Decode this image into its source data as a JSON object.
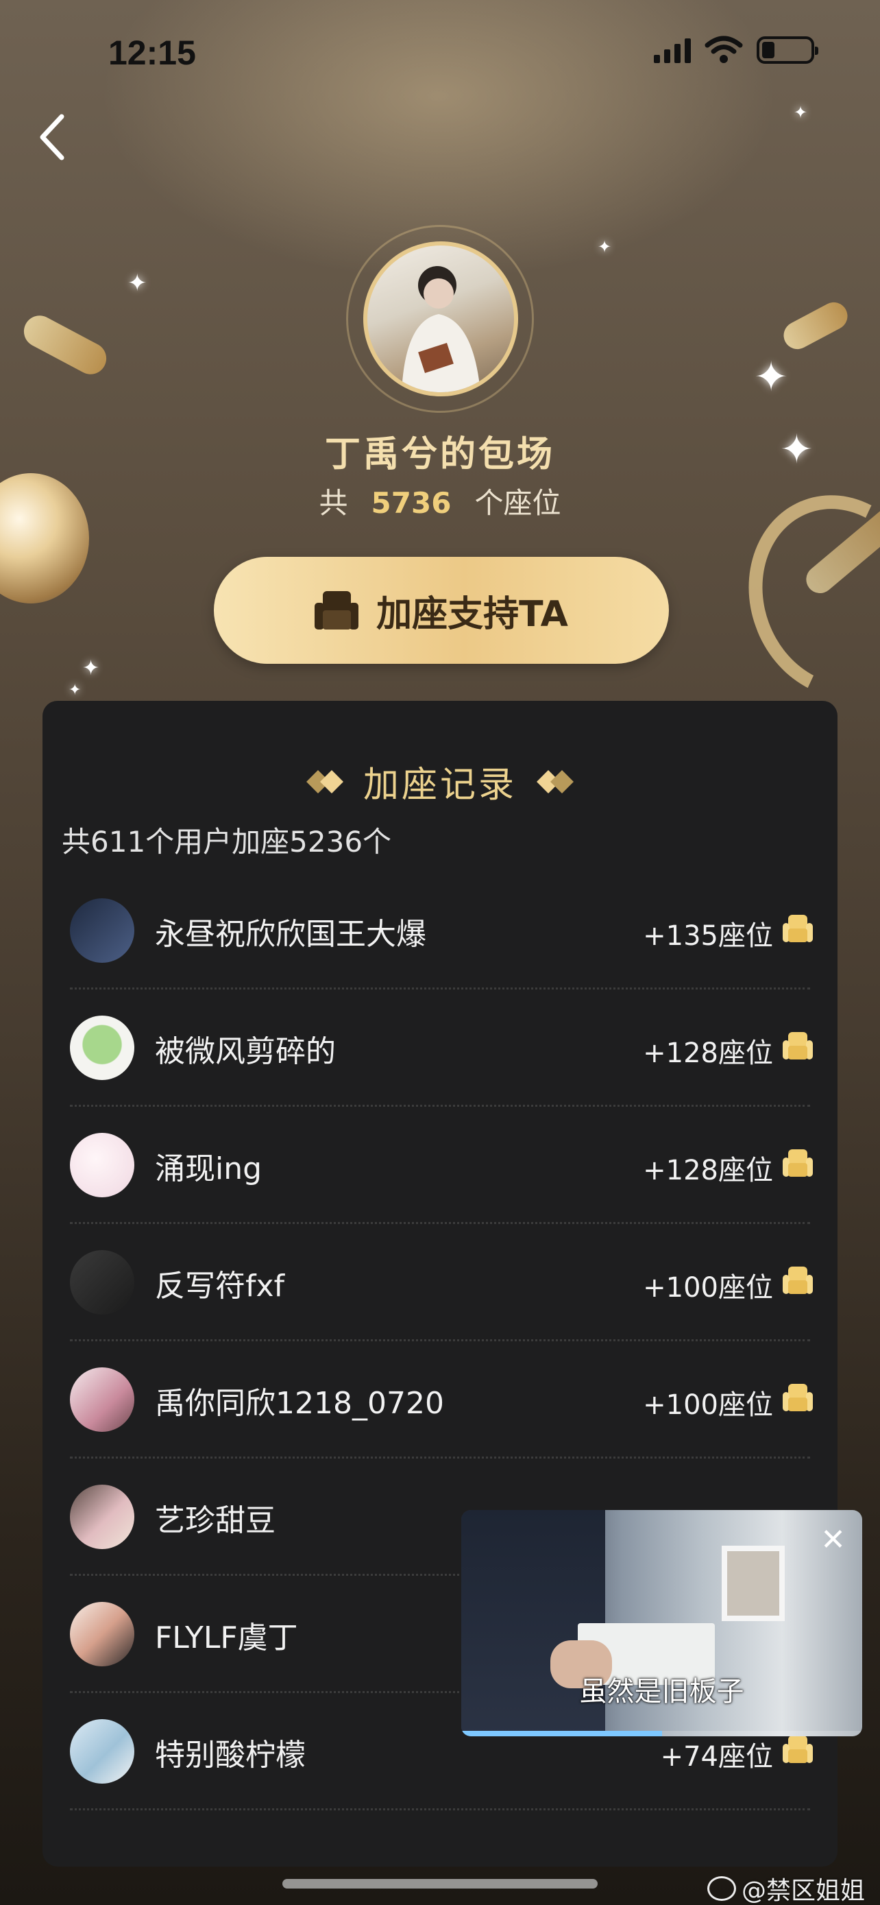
{
  "status_bar": {
    "time": "12:15",
    "battery_level": 0.2
  },
  "header": {
    "back_icon": "chevron-left-icon"
  },
  "profile": {
    "title": "丁禹兮的包场",
    "total_prefix": "共",
    "total_seats": "5736",
    "total_suffix": "个座位"
  },
  "support_button": {
    "label": "加座支持TA",
    "icon": "sofa-icon"
  },
  "records": {
    "title": "加座记录",
    "summary": "共611个用户加座5236个",
    "items": [
      {
        "name": "永昼祝欣欣国王大爆",
        "seats": "+135座位",
        "avatar_color": "#3a4a66"
      },
      {
        "name": "被微风剪碎的",
        "seats": "+128座位",
        "avatar_color": "#9fd08a"
      },
      {
        "name": "涌现ing",
        "seats": "+128座位",
        "avatar_color": "#f2dfe6"
      },
      {
        "name": "反写符fxf",
        "seats": "+100座位",
        "avatar_color": "#2b2b2b"
      },
      {
        "name": "禹你同欣1218_0720",
        "seats": "+100座位",
        "avatar_color": "#d9b7c2"
      },
      {
        "name": "艺珍甜豆",
        "seats": "",
        "avatar_color": "#c9a69a"
      },
      {
        "name": "FLYLF虞丁",
        "seats": "",
        "avatar_color": "#e8d6cc"
      },
      {
        "name": "特别酸柠檬",
        "seats": "+74座位",
        "avatar_color": "#b8d3e6"
      }
    ]
  },
  "mini_player": {
    "caption": "虽然是旧板子",
    "close_icon": "close-icon",
    "progress": 0.5
  },
  "watermark": {
    "text": "@禁区姐姐"
  },
  "colors": {
    "gold": "#ecd28e",
    "button_gold": "#ecc987",
    "panel_bg": "#1e1e1f"
  }
}
